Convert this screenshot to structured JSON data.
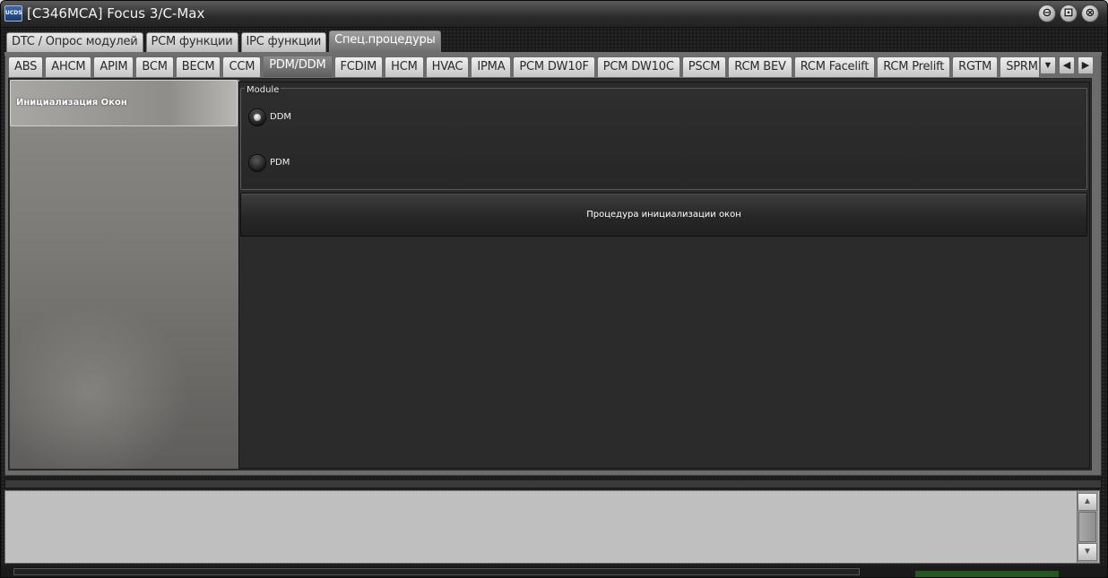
{
  "window": {
    "app_icon_text": "UCDS",
    "title": "[C346MCA] Focus 3/C-Max",
    "controls": {
      "minimize": "⊖",
      "maximize": "⊡",
      "close": "⊗"
    }
  },
  "main_tabs": [
    {
      "label": "DTC / Опрос модулей",
      "active": false
    },
    {
      "label": "PCM функции",
      "active": false
    },
    {
      "label": "IPC функции",
      "active": false
    },
    {
      "label": "Спец.процедуры",
      "active": true
    }
  ],
  "module_tabs": [
    {
      "label": "ABS"
    },
    {
      "label": "AHCM"
    },
    {
      "label": "APIM"
    },
    {
      "label": "BCM"
    },
    {
      "label": "BECM"
    },
    {
      "label": "CCM"
    },
    {
      "label": "PDM/DDM",
      "active": true
    },
    {
      "label": "FCDIM"
    },
    {
      "label": "HCM"
    },
    {
      "label": "HVAC"
    },
    {
      "label": "IPMA"
    },
    {
      "label": "PCM DW10F"
    },
    {
      "label": "PCM DW10C"
    },
    {
      "label": "PSCM"
    },
    {
      "label": "RCM BEV"
    },
    {
      "label": "RCM Facelift"
    },
    {
      "label": "RCM Prelift"
    },
    {
      "label": "RGTM"
    },
    {
      "label": "SPRM"
    }
  ],
  "tab_controls": {
    "dropdown": "▼",
    "prev": "◀",
    "next": "▶"
  },
  "procedures": [
    {
      "label": "Инициализация Окон",
      "selected": true
    }
  ],
  "module_group": {
    "legend": "Module",
    "options": [
      {
        "label": "DDM",
        "checked": true
      },
      {
        "label": "PDM",
        "checked": false
      }
    ]
  },
  "action_button": {
    "label": "Процедура инициализации окон"
  },
  "log": {
    "text": "",
    "scroll_up": "▲",
    "scroll_down": "▼"
  }
}
